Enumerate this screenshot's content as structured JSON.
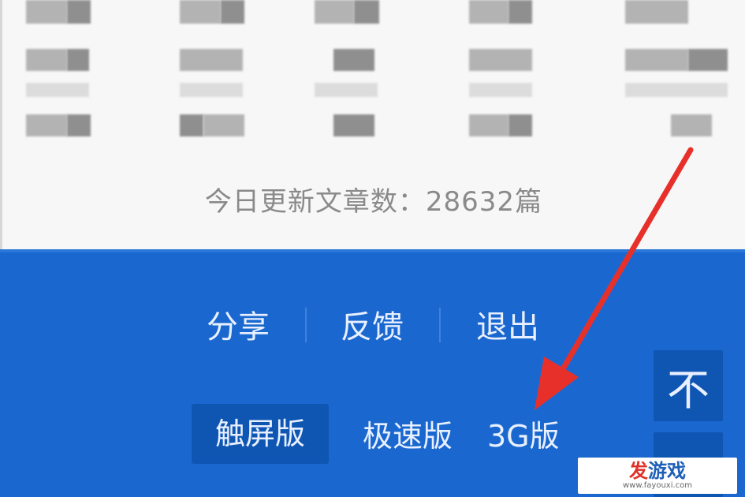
{
  "stats": {
    "today_articles": "今日更新文章数：28632篇"
  },
  "footer_menu": [
    "分享",
    "反馈",
    "退出"
  ],
  "versions": {
    "active": "触屏版",
    "others": [
      "极速版",
      "3G版"
    ]
  },
  "back_to_top_icon": "不",
  "watermark": {
    "title_a": "发",
    "title_b": "游戏",
    "url": "www.fayouxi.com"
  },
  "colors": {
    "accent": "#1a68cf",
    "annotation": "#e8302a"
  }
}
